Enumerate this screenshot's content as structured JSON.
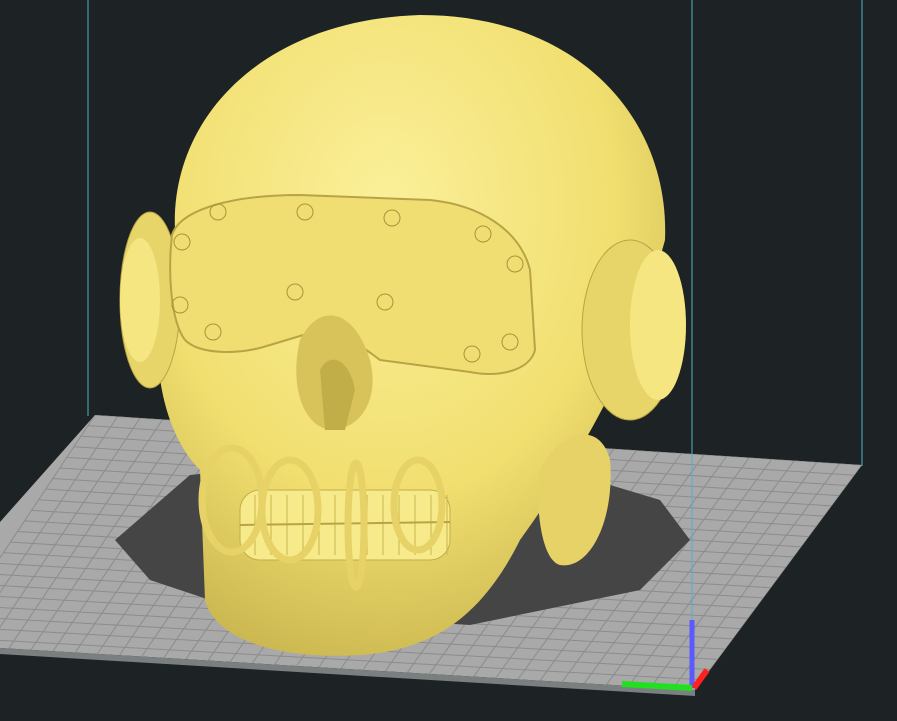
{
  "viewport": {
    "background_color": "#1d2324",
    "build_plate_color": "#a9a9a9",
    "grid_line_color": "#8c8c8c",
    "volume_line_color": "#4fb3c9",
    "shadow_color": "#454545",
    "model_color": "#f3e37a",
    "model_shade_color": "#c9b54e"
  },
  "model": {
    "name": "skull-with-goggles"
  },
  "axes": {
    "x_color": "#ff2020",
    "y_color": "#20e020",
    "z_color": "#5a5aff"
  }
}
